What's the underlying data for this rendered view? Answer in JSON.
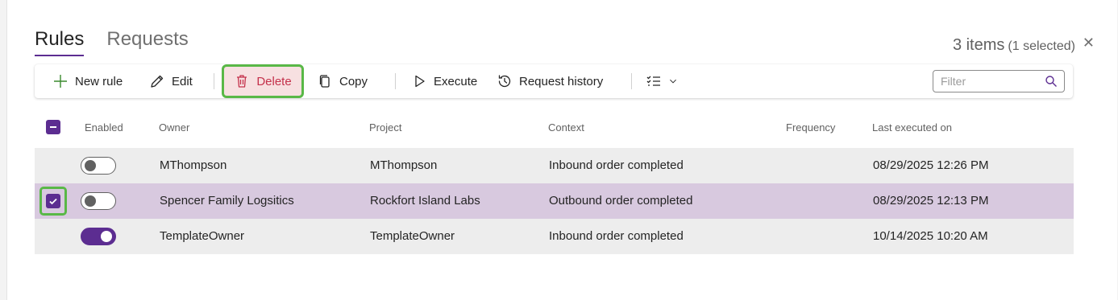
{
  "tabs": [
    {
      "label": "Rules",
      "active": true
    },
    {
      "label": "Requests",
      "active": false
    }
  ],
  "summary": {
    "count": "3 items",
    "selected": "(1 selected)"
  },
  "toolbar": {
    "new_rule": "New rule",
    "edit": "Edit",
    "delete": "Delete",
    "copy": "Copy",
    "execute": "Execute",
    "request_history": "Request history",
    "filter_placeholder": "Filter"
  },
  "table": {
    "columns": [
      "Enabled",
      "Owner",
      "Project",
      "Context",
      "Frequency",
      "Last executed on"
    ],
    "rows": [
      {
        "selected": false,
        "enabled": false,
        "owner": "MThompson",
        "project": "MThompson",
        "context": "Inbound order completed",
        "frequency": "",
        "last_executed": "08/29/2025 12:26 PM"
      },
      {
        "selected": true,
        "enabled": false,
        "owner": "Spencer Family Logsitics",
        "project": "Rockfort Island Labs",
        "context": "Outbound order completed",
        "frequency": "",
        "last_executed": "08/29/2025 12:13 PM"
      },
      {
        "selected": false,
        "enabled": true,
        "owner": "TemplateOwner",
        "project": "TemplateOwner",
        "context": "Inbound order completed",
        "frequency": "",
        "last_executed": "10/14/2025 10:20 AM"
      }
    ]
  },
  "colors": {
    "accent": "#5c2d91",
    "highlight": "#59b847",
    "selected_row": "#d8c9df",
    "delete_red": "#c4314b"
  },
  "icons": [
    "plus-icon",
    "pencil-icon",
    "trash-icon",
    "copy-icon",
    "play-icon",
    "history-icon",
    "checklist-icon",
    "chevron-down-icon",
    "search-icon",
    "close-icon"
  ]
}
